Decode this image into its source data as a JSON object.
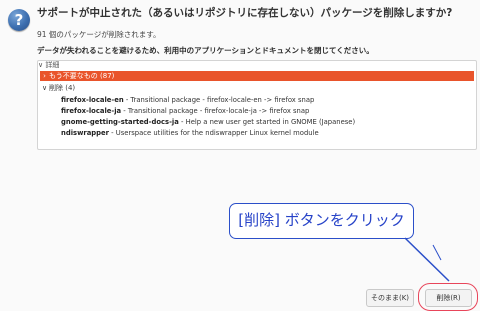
{
  "dialog": {
    "title": "サポートが中止された（あるいはリポジトリに存在しない）パッケージを削除しますか?",
    "count_text": "91 個のパッケージが削除されます。",
    "warning_text": "データが失われることを避けるため、利用中のアプリケーションとドキュメントを閉じてください。",
    "icon": "question-icon",
    "icon_glyph": "?"
  },
  "details": {
    "toggle_label": "∨ 詳細",
    "groups": [
      {
        "chevron": "›",
        "label": "もう不要なもの (87)",
        "selected": true
      },
      {
        "chevron": "∨",
        "label": "削除 (4)",
        "selected": false
      }
    ],
    "packages": [
      {
        "name": "firefox-locale-en",
        "description": " - Transitional package - firefox-locale-en -> firefox snap"
      },
      {
        "name": "firefox-locale-ja",
        "description": " - Transitional package - firefox-locale-ja -> firefox snap"
      },
      {
        "name": "gnome-getting-started-docs-ja",
        "description": " - Help a new user get started in GNOME (Japanese)"
      },
      {
        "name": "ndiswrapper",
        "description": " - Userspace utilities for the ndiswrapper Linux kernel module"
      }
    ]
  },
  "annotation": {
    "text": "[削除] ボタンをクリック",
    "color": "#2743c8"
  },
  "buttons": {
    "keep_label": "そのまま(K)",
    "delete_label": "削除(R)"
  },
  "colors": {
    "selection": "#e9542b",
    "highlight": "#e8455a"
  }
}
